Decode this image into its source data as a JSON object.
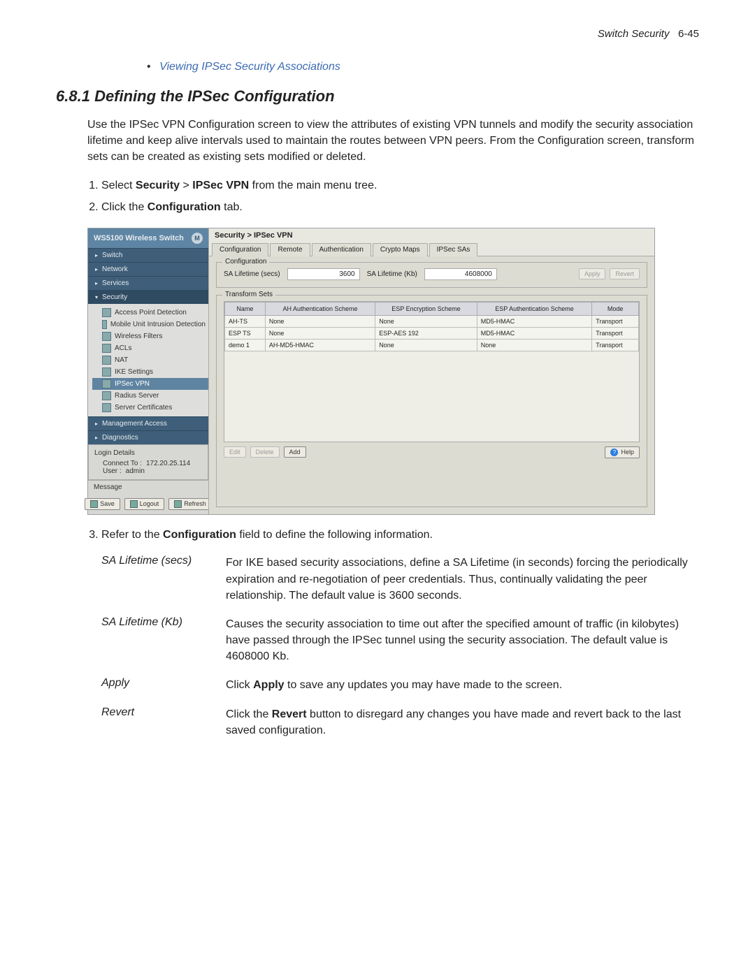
{
  "page_header": {
    "title": "Switch Security",
    "num": "6-45"
  },
  "bullet_link": "Viewing IPSec Security Associations",
  "section": {
    "num": "6.8.1",
    "title": "Defining the IPSec Configuration"
  },
  "intro": "Use the IPSec VPN Configuration screen to view the attributes of existing VPN tunnels and modify the security association lifetime and keep alive intervals used to maintain the routes between VPN peers. From the Configuration screen, transform sets can be created as existing sets modified or deleted.",
  "steps": {
    "s1_a": "Select ",
    "s1_b": "Security",
    "s1_c": " > ",
    "s1_d": "IPSec VPN",
    "s1_e": " from the main menu tree.",
    "s2_a": "Click the ",
    "s2_b": "Configuration",
    "s2_c": " tab.",
    "s3_a": "Refer to the ",
    "s3_b": "Configuration",
    "s3_c": " field to define the following information."
  },
  "app": {
    "brand": "WS5100 Wireless Switch",
    "brand_badge": "M",
    "nav": {
      "switch": "Switch",
      "network": "Network",
      "services": "Services",
      "security": "Security",
      "mgmt": "Management Access",
      "diag": "Diagnostics"
    },
    "tree": {
      "apd": "Access Point Detection",
      "mui": "Mobile Unit Intrusion Detection",
      "wf": "Wireless Filters",
      "acls": "ACLs",
      "nat": "NAT",
      "ike": "IKE Settings",
      "ipsec": "IPSec VPN",
      "radius": "Radius Server",
      "certs": "Server Certificates"
    },
    "login": {
      "title": "Login Details",
      "connect_lbl": "Connect To :",
      "connect_val": "172.20.25.114",
      "user_lbl": "User :",
      "user_val": "admin"
    },
    "message_lbl": "Message",
    "buttons": {
      "save": "Save",
      "logout": "Logout",
      "refresh": "Refresh",
      "apply": "Apply",
      "revert": "Revert",
      "edit": "Edit",
      "delete": "Delete",
      "add": "Add",
      "help": "Help"
    },
    "crumb": "Security > IPSec VPN",
    "tabs": {
      "cfg": "Configuration",
      "remote": "Remote",
      "auth": "Authentication",
      "crypto": "Crypto Maps",
      "sas": "IPSec SAs"
    },
    "cfg": {
      "legend": "Configuration",
      "sa_secs_lbl": "SA Lifetime (secs)",
      "sa_secs_val": "3600",
      "sa_kb_lbl": "SA Lifetime (Kb)",
      "sa_kb_val": "4608000"
    },
    "tsets": {
      "legend": "Transform Sets",
      "headers": {
        "name": "Name",
        "ah": "AH Authentication Scheme",
        "espenc": "ESP Encryption Scheme",
        "espauth": "ESP Authentication Scheme",
        "mode": "Mode"
      },
      "rows": [
        {
          "name": "AH-TS",
          "ah": "None",
          "espenc": "None",
          "espauth": "MD5-HMAC",
          "mode": "Transport"
        },
        {
          "name": "ESP TS",
          "ah": "None",
          "espenc": "ESP-AES 192",
          "espauth": "MD5-HMAC",
          "mode": "Transport"
        },
        {
          "name": "demo 1",
          "ah": "AH-MD5-HMAC",
          "espenc": "None",
          "espauth": "None",
          "mode": "Transport"
        }
      ]
    }
  },
  "defs": [
    {
      "term": "SA Lifetime (secs)",
      "desc": "For IKE based security associations, define a SA Lifetime (in seconds) forcing the periodically expiration and re-negotiation of peer credentials. Thus, continually validating the peer relationship. The default value is 3600 seconds."
    },
    {
      "term": "SA Lifetime (Kb)",
      "desc": "Causes the security association to time out after the specified amount of traffic (in kilobytes) have passed through the IPSec tunnel using the security association. The default value is 4608000 Kb."
    },
    {
      "term": "Apply",
      "desc_a": "Click ",
      "desc_b": "Apply",
      "desc_c": " to save any updates you may have made to the screen."
    },
    {
      "term": "Revert",
      "desc_a": "Click the ",
      "desc_b": "Revert",
      "desc_c": " button to disregard any changes you have made and revert back to the last saved configuration."
    }
  ]
}
